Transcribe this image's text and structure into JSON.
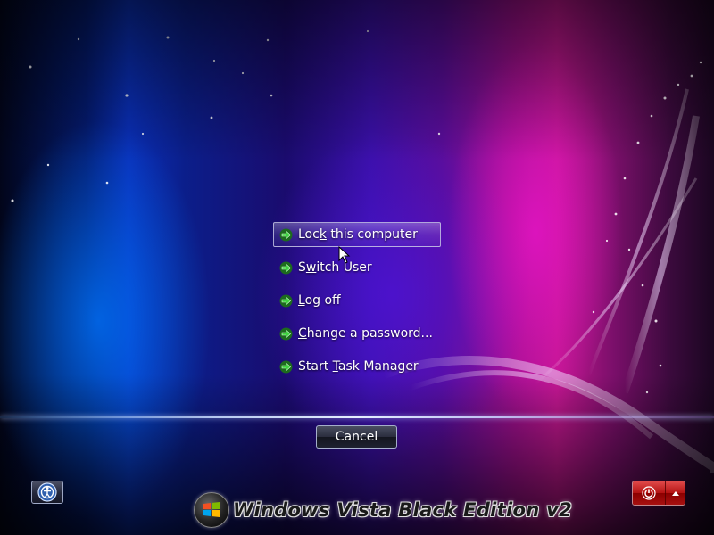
{
  "menu": {
    "items": [
      {
        "pre": "Loc",
        "key": "k",
        "post": " this computer",
        "selected": true
      },
      {
        "pre": "S",
        "key": "w",
        "post": "itch User",
        "selected": false
      },
      {
        "pre": "",
        "key": "L",
        "post": "og off",
        "selected": false
      },
      {
        "pre": "",
        "key": "C",
        "post": "hange a password...",
        "selected": false
      },
      {
        "pre": "Start ",
        "key": "T",
        "post": "ask Manager",
        "selected": false
      }
    ],
    "arrow_icon": "green-arrow-icon"
  },
  "cancel": {
    "label": "Cancel"
  },
  "ease_of_access": {
    "icon": "ease-of-access-icon"
  },
  "power": {
    "icon": "power-icon",
    "menu_icon": "triangle-up-icon"
  },
  "branding": {
    "text": "Windows Vista Black Edition v2",
    "logo": "windows-flag-icon"
  },
  "colors": {
    "power_red": "#b31212",
    "arrow_green": "#3fd23f"
  }
}
